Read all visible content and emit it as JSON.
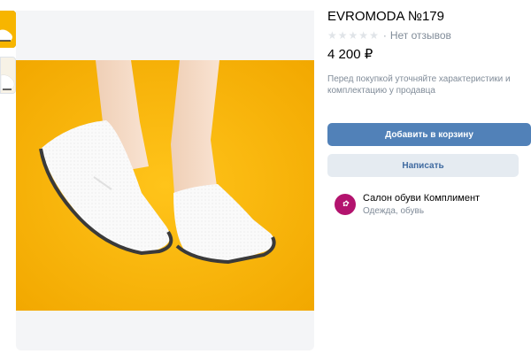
{
  "product": {
    "title": "EVROMODA №179",
    "rating_stars": 5,
    "rating_filled": 0,
    "reviews_text": "Нет отзывов",
    "price": "4 200 ₽",
    "note": "Перед покупкой уточняйте характеристики и комплектацию у продавца"
  },
  "actions": {
    "add_to_cart": "Добавить в корзину",
    "message": "Написать"
  },
  "seller": {
    "name": "Салон обуви Комплимент",
    "category": "Одежда, обувь"
  },
  "colors": {
    "accent": "#5181b8",
    "secondary_bg": "#e5ebf1",
    "photo_bg": "#f7b500",
    "avatar_bg": "#b3136e"
  },
  "icons": {
    "star": "star-icon",
    "avatar": "shop-avatar-icon"
  }
}
